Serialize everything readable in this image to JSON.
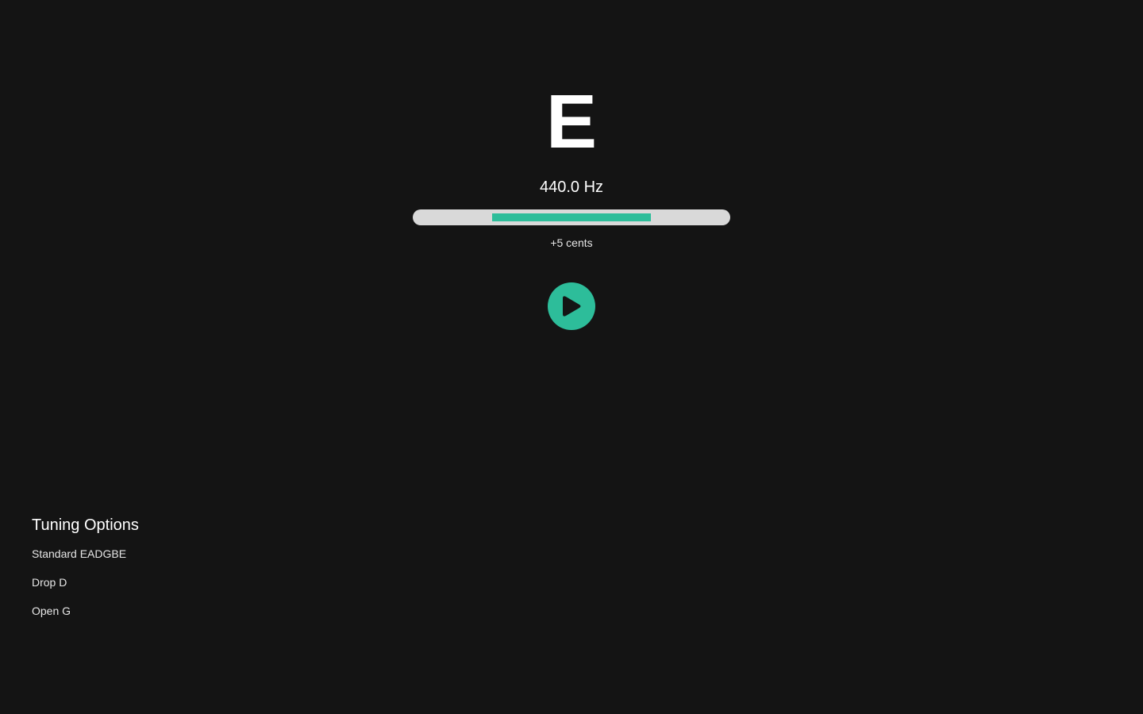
{
  "tuner": {
    "note": "E",
    "frequency": "440.0 Hz",
    "cents_label": "+5 cents",
    "meter_fill_fraction": 0.5,
    "play_icon": "play-icon"
  },
  "tuning_options": {
    "title": "Tuning Options",
    "items": [
      {
        "label": "Standard EADGBE"
      },
      {
        "label": "Drop D"
      },
      {
        "label": "Open G"
      }
    ]
  },
  "colors": {
    "background": "#141414",
    "accent": "#2dbd9a",
    "meter_track": "#d9d9d9",
    "text": "#ffffff"
  }
}
